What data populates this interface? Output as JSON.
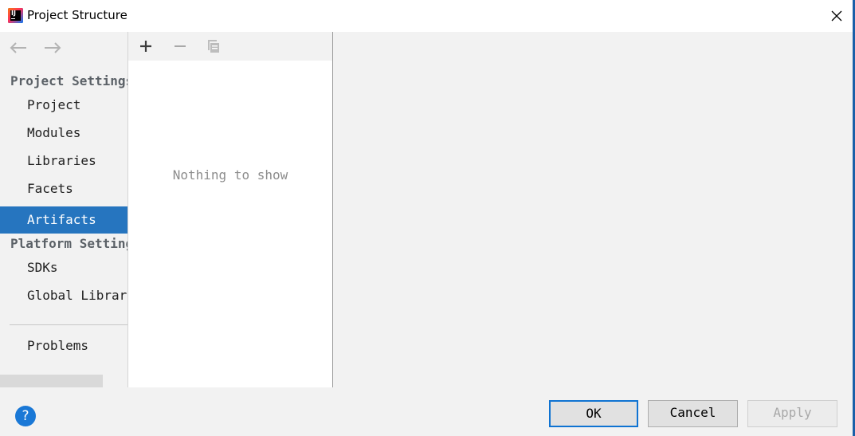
{
  "window": {
    "title": "Project Structure"
  },
  "sidebar": {
    "project_settings_header": "Project Settings",
    "project_items": [
      {
        "label": "Project"
      },
      {
        "label": "Modules"
      },
      {
        "label": "Libraries"
      },
      {
        "label": "Facets"
      },
      {
        "label": "Artifacts",
        "selected": true
      }
    ],
    "platform_settings_header": "Platform Settings",
    "platform_items": [
      {
        "label": "SDKs"
      },
      {
        "label": "Global Libraries"
      }
    ],
    "problems_label": "Problems"
  },
  "list_panel": {
    "toolbar_icons": [
      "add-icon",
      "remove-icon",
      "copy-icon"
    ],
    "empty_text": "Nothing to show"
  },
  "footer": {
    "help_label": "?",
    "ok_label": "OK",
    "cancel_label": "Cancel",
    "apply_label": "Apply"
  },
  "colors": {
    "selection": "#2675bf",
    "ok_border": "#0f73d2",
    "help": "#1a78d6"
  }
}
